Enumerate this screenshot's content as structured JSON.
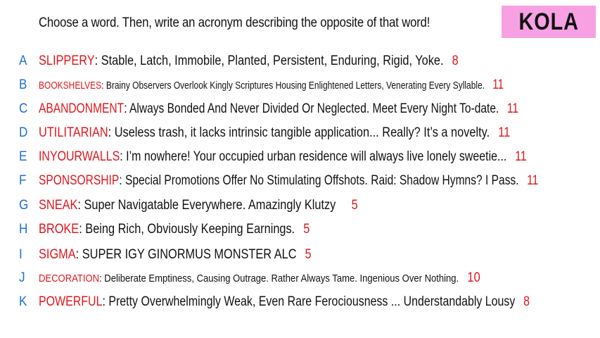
{
  "prompt": "Choose a word. Then, write an acronym describing the opposite of that word!",
  "badge": "KOLA",
  "rows": [
    {
      "letter": "A",
      "word": "SLIPPERY",
      "definition": ":  Stable, Latch, Immobile, Planted, Persistent, Enduring, Rigid, Yoke.",
      "score": "8"
    },
    {
      "letter": "B",
      "word": "BOOKSHELVES",
      "definition": ":  Brainy Observers Overlook Kingly Scriptures Housing Enlightened Letters, Venerating Every Syllable.",
      "score": "11"
    },
    {
      "letter": "C",
      "word": "ABANDONMENT",
      "definition": ":  Always Bonded And Never Divided Or Neglected. Meet Every Night To-date.",
      "score": "11"
    },
    {
      "letter": "D",
      "word": "UTILITARIAN",
      "definition": ":  Useless trash, it lacks intrinsic tangible application... Really? It’s a novelty.",
      "score": "11"
    },
    {
      "letter": "E",
      "word": "INYOURWALLS",
      "definition": ":  I’m nowhere! Your occupied urban residence will always live lonely sweetie...",
      "score": "11"
    },
    {
      "letter": "F",
      "word": "SPONSORSHIP",
      "definition": ":  Special Promotions Offer No Stimulating Offshots. Raid: Shadow Hymns? I Pass.",
      "score": "11"
    },
    {
      "letter": "G",
      "word": "SNEAK",
      "definition": ":  Super Navigatable Everywhere. Amazingly Klutzy",
      "score": "5"
    },
    {
      "letter": "H",
      "word": "BROKE",
      "definition": ":  Being Rich, Obviously Keeping Earnings.",
      "score": "5"
    },
    {
      "letter": "I",
      "word": "SIGMA",
      "definition": ":  SUPER IGY GINORMUS MONSTER ALC",
      "score": "5"
    },
    {
      "letter": "J",
      "word": "DECORATION",
      "definition": ":  Deliberate Emptiness, Causing Outrage. Rather Always Tame. Ingenious Over Nothing.",
      "score": "10"
    },
    {
      "letter": "K",
      "word": "POWERFUL",
      "definition": ":  Pretty Overwhelmingly Weak, Even Rare Ferociousness ... Understandably Lousy",
      "score": "8"
    }
  ]
}
